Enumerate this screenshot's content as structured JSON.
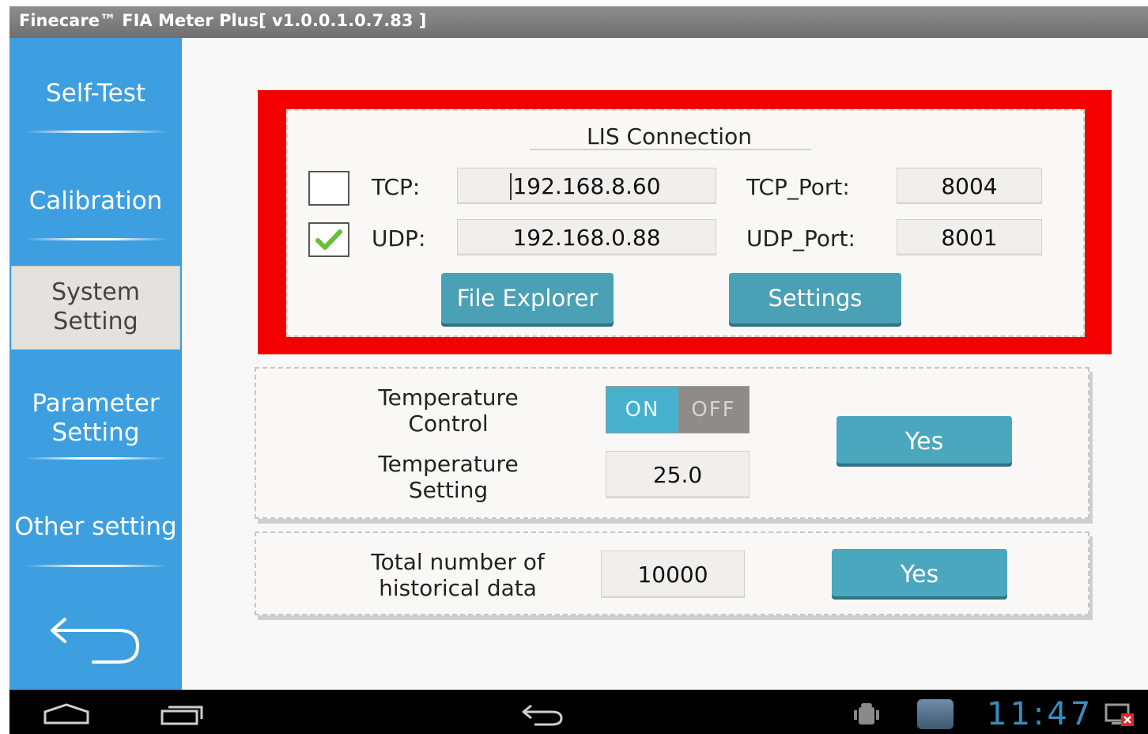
{
  "window": {
    "title": "Finecare™ FIA Meter Plus[ v1.0.0.1.0.7.83 ]"
  },
  "sidebar": {
    "items": [
      {
        "label": "Self-Test"
      },
      {
        "label": "Calibration"
      },
      {
        "label": "System",
        "label2": "Setting",
        "selected": true
      },
      {
        "label": "Parameter",
        "label2": "Setting"
      },
      {
        "label": "Other setting"
      }
    ],
    "back_icon": "back-arrow-icon"
  },
  "lis": {
    "heading": "LIS Connection",
    "tcp": {
      "checked": false,
      "label": "TCP:",
      "ip": "192.168.8.60",
      "port_label": "TCP_Port:",
      "port": "8004"
    },
    "udp": {
      "checked": true,
      "label": "UDP:",
      "ip": "192.168.0.88",
      "port_label": "UDP_Port:",
      "port": "8001"
    },
    "file_explorer_label": "File Explorer",
    "settings_label": "Settings"
  },
  "temperature": {
    "control_label_1": "Temperature",
    "control_label_2": "Control",
    "toggle_on": "ON",
    "toggle_off": "OFF",
    "setting_label_1": "Temperature",
    "setting_label_2": "Setting",
    "setting_value": "25.0",
    "yes_label": "Yes"
  },
  "history": {
    "label_1": "Total number of",
    "label_2": "historical data",
    "value": "10000",
    "yes_label": "Yes"
  },
  "system_bar": {
    "clock": "11:47",
    "icons": [
      "home-icon",
      "recent-apps-icon",
      "back-icon",
      "android-debug-icon",
      "app-notification-icon",
      "screen-off-icon"
    ]
  },
  "colors": {
    "sidebar": "#3d9fe0",
    "highlight": "#f40000",
    "button": "#4aa0b4",
    "toggle_on": "#47b0cc"
  }
}
